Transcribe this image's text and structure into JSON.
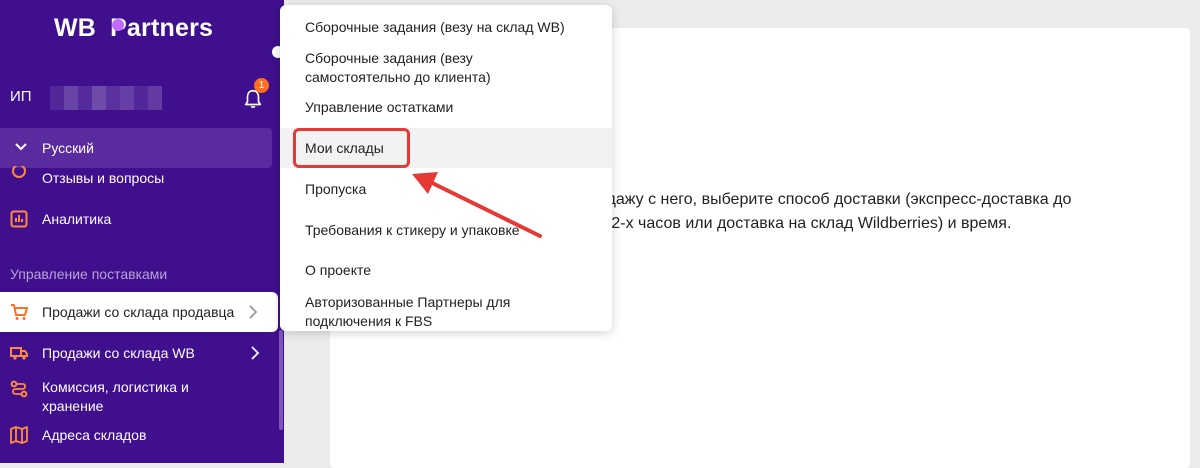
{
  "brand": {
    "logo_text_left": "WB",
    "logo_text_right": "Partners"
  },
  "user": {
    "label": "ИП"
  },
  "notifications": {
    "count": "1"
  },
  "language": {
    "label": "Русский"
  },
  "sidebar": {
    "items": [
      {
        "label": "Отзывы и вопросы",
        "icon": "reviews-icon"
      },
      {
        "label": "Аналитика",
        "icon": "analytics-icon"
      }
    ],
    "section_title": "Управление поставками",
    "supply_items": [
      {
        "label": "Продажи со склада продавца",
        "icon": "cart-icon",
        "active": true
      },
      {
        "label": "Продажи со склада WB",
        "icon": "truck-icon"
      },
      {
        "label": "Комиссия, логистика и хранение",
        "icon": "route-icon"
      },
      {
        "label": "Адреса складов",
        "icon": "map-icon"
      }
    ]
  },
  "menu": {
    "items": [
      {
        "label": "Сборочные задания (везу на склад WB)"
      },
      {
        "label_line1": "Сборочные задания (везу",
        "label_line2": "самостоятельно до клиента)"
      },
      {
        "label": "Управление остатками"
      },
      {
        "label": "Мои склады",
        "highlighted": true
      },
      {
        "label": "Пропуска"
      },
      {
        "label": "Требования к стикеру и упаковке"
      },
      {
        "label": "О проекте"
      },
      {
        "label_line1": "Авторизованные Партнеры для",
        "label_line2": "подключения к FBS"
      }
    ]
  },
  "main": {
    "text_line1": "одажу с него, выберите способ доставки (экспресс-доставка до",
    "text_line2": "и 2-х часов или доставка на склад Wildberries) и время."
  },
  "colors": {
    "sidebar": "#3f0f8e",
    "accent_orange": "#ff6f1e",
    "annotation_red": "#e53935"
  }
}
